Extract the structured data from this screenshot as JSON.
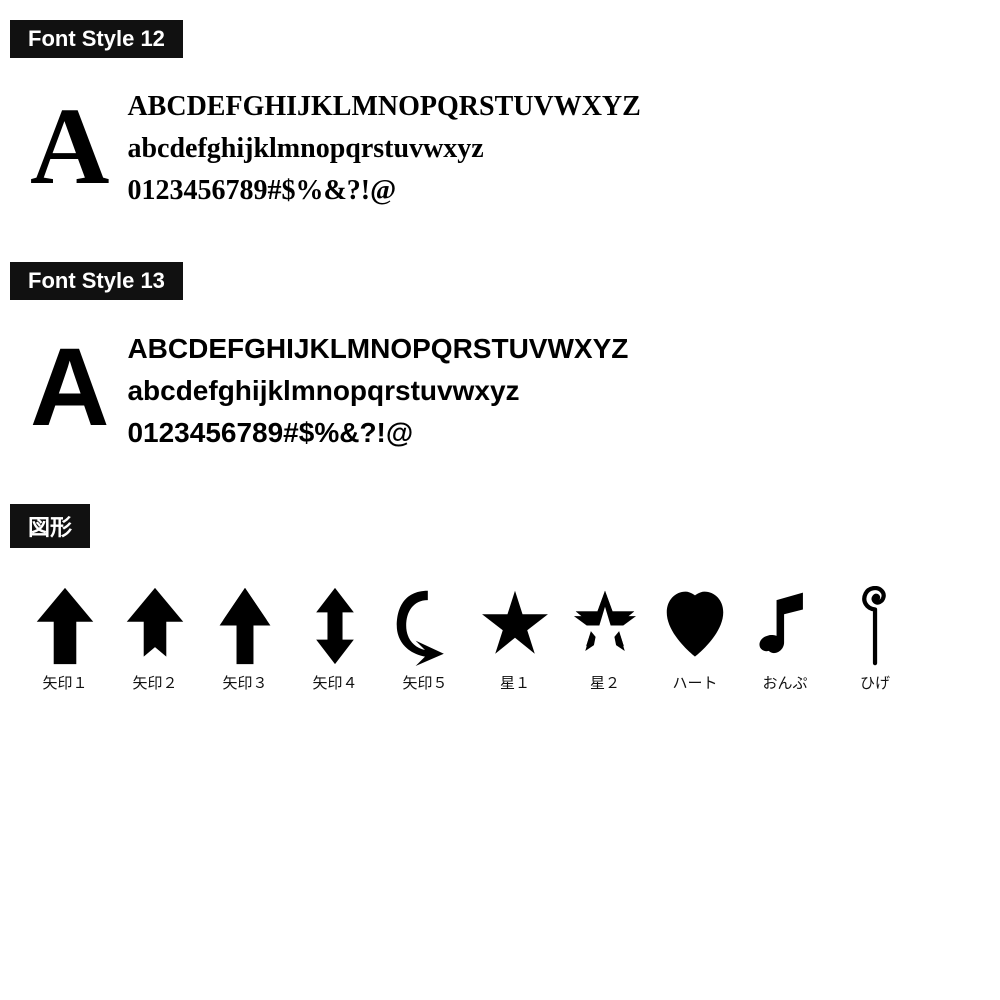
{
  "sections": [
    {
      "id": "font12",
      "label": "Font Style 12",
      "bigLetter": "A",
      "lines": [
        "ABCDEFGHIJKLMNOPQRSTUVWXYZ",
        "abcdefghijklmnopqrstuvwxyz",
        "0123456789#$%&?!@"
      ],
      "fontClass": "style12"
    },
    {
      "id": "font13",
      "label": "Font Style 13",
      "bigLetter": "A",
      "lines": [
        "ABCDEFGHIJKLMNOPQRSTUVWXYZ",
        "abcdefghijklmnopqrstuvwxyz",
        "0123456789#$%&?!@"
      ],
      "fontClass": "style13"
    }
  ],
  "figures": {
    "sectionLabel": "図形",
    "items": [
      {
        "id": "yazirushi1",
        "label": "矢印１"
      },
      {
        "id": "yazirushi2",
        "label": "矢印２"
      },
      {
        "id": "yazirushi3",
        "label": "矢印３"
      },
      {
        "id": "yazirushi4",
        "label": "矢印４"
      },
      {
        "id": "yazirushi5",
        "label": "矢印５"
      },
      {
        "id": "hoshi1",
        "label": "星１"
      },
      {
        "id": "hoshi2",
        "label": "星２"
      },
      {
        "id": "heart",
        "label": "ハート"
      },
      {
        "id": "onpu",
        "label": "おんぷ"
      },
      {
        "id": "hige",
        "label": "ひげ"
      }
    ]
  }
}
